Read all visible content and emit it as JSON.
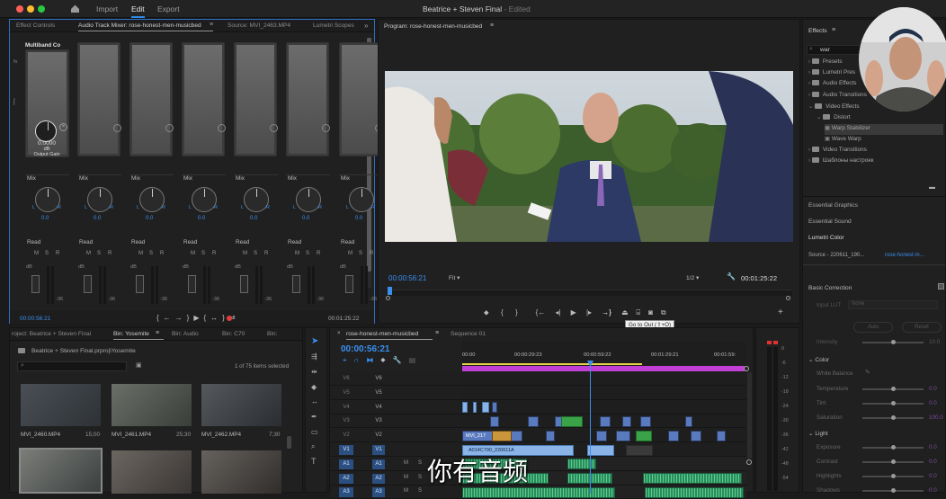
{
  "app": {
    "title": "Beatrice + Steven Final",
    "edited": " - Edited",
    "menu": [
      "Import",
      "Edit",
      "Export"
    ],
    "active_menu": "Edit"
  },
  "left_panel": {
    "tabs": [
      "Effect Controls",
      "Audio Track Mixer: rose-honest-men-musicbed",
      "Source: MVI_2463.MP4",
      "Lumetri Scopes"
    ],
    "first_strip": {
      "name": "Multiband Co",
      "gain": "0.0000",
      "unit": "dB",
      "label": "Output Gain"
    },
    "mix_label": "Mix",
    "pan_value": "0.0",
    "read_label": "Read",
    "db_label": "dB",
    "minus36": "-36",
    "timecode_left": "00:00:56:21",
    "timecode_right": "00:01:25:22"
  },
  "program": {
    "title": "Program: rose-honest-men-musicbed",
    "timecode": "00:00:56:21",
    "fit": "Fit",
    "ratio": "1/2",
    "duration": "00:01:25:22",
    "tooltip": "Go to Out (⇧+O)"
  },
  "project": {
    "tabs": [
      "roject: Beatrice + Steven Final",
      "Bin: Yosemite",
      "Bin: Audio",
      "Bin: C70",
      "Bin:"
    ],
    "path": "Beatrice + Steven Final.prproj\\Yosemite",
    "count": "1 of 75 items selected",
    "items": [
      {
        "name": "MVI_2460.MP4",
        "dur": "15;00"
      },
      {
        "name": "MVI_2461.MP4",
        "dur": "25;30"
      },
      {
        "name": "MVI_2462.MP4",
        "dur": "7;30"
      }
    ]
  },
  "timeline": {
    "tabs": [
      "rose-honest-men-musicbed",
      "Sequence 01"
    ],
    "timecode": "00:00:56:21",
    "ruler": [
      "00:00",
      "00:00:29:23",
      "00:00:59:22",
      "00:01:29:21",
      "00:01:59:"
    ],
    "tracks": [
      "V6",
      "V5",
      "V4",
      "V3",
      "V2",
      "V1",
      "A1",
      "A2",
      "A3"
    ],
    "clip_labels": [
      "MVI_217",
      "A014C790_220611A"
    ],
    "meter_labels": [
      "0",
      "-6",
      "-12",
      "-18",
      "-24",
      "-30",
      "-36",
      "-42",
      "-48",
      "-54"
    ]
  },
  "effects": {
    "title": "Effects",
    "search": "war",
    "tree": [
      {
        "label": "Presets",
        "level": 0
      },
      {
        "label": "Lumetri Pres",
        "level": 0
      },
      {
        "label": "Audio Effects",
        "level": 0
      },
      {
        "label": "Audio Transitions",
        "level": 0
      },
      {
        "label": "Video Effects",
        "level": 0
      },
      {
        "label": "Distort",
        "level": 1
      },
      {
        "label": "Warp Stabilizer",
        "level": 2
      },
      {
        "label": "Wave Warp",
        "level": 2
      },
      {
        "label": "Video Transitions",
        "level": 0
      },
      {
        "label": "Шаблоны настроек",
        "level": 0
      }
    ],
    "sections": [
      "Essential Graphics",
      "Essential Sound",
      "Lumetri Color"
    ],
    "source": "Source - 220611_190...",
    "source_target": "rose-honest-m...",
    "basic_correction": "Basic Correction",
    "input_lut": "Input LUT",
    "lut_value": "None",
    "auto": "Auto",
    "reset": "Reset",
    "intensity": "Intensity",
    "intensity_val": "10.0",
    "color": "Color",
    "white_balance": "White Balance",
    "controls": [
      {
        "label": "Temperature",
        "val": "0.0"
      },
      {
        "label": "Tint",
        "val": "0.0"
      },
      {
        "label": "Saturation",
        "val": "100.0"
      }
    ],
    "light": "Light",
    "light_controls": [
      {
        "label": "Exposure",
        "val": "0.0"
      },
      {
        "label": "Contrast",
        "val": "0.0"
      },
      {
        "label": "Highlights",
        "val": "0.0"
      },
      {
        "label": "Shadows",
        "val": "0.0"
      }
    ]
  },
  "subtitle": "你有音频",
  "colors": {
    "accent": "#2d8ceb",
    "playhead": "#3a8ff0",
    "work_area": "#c13fd6"
  }
}
